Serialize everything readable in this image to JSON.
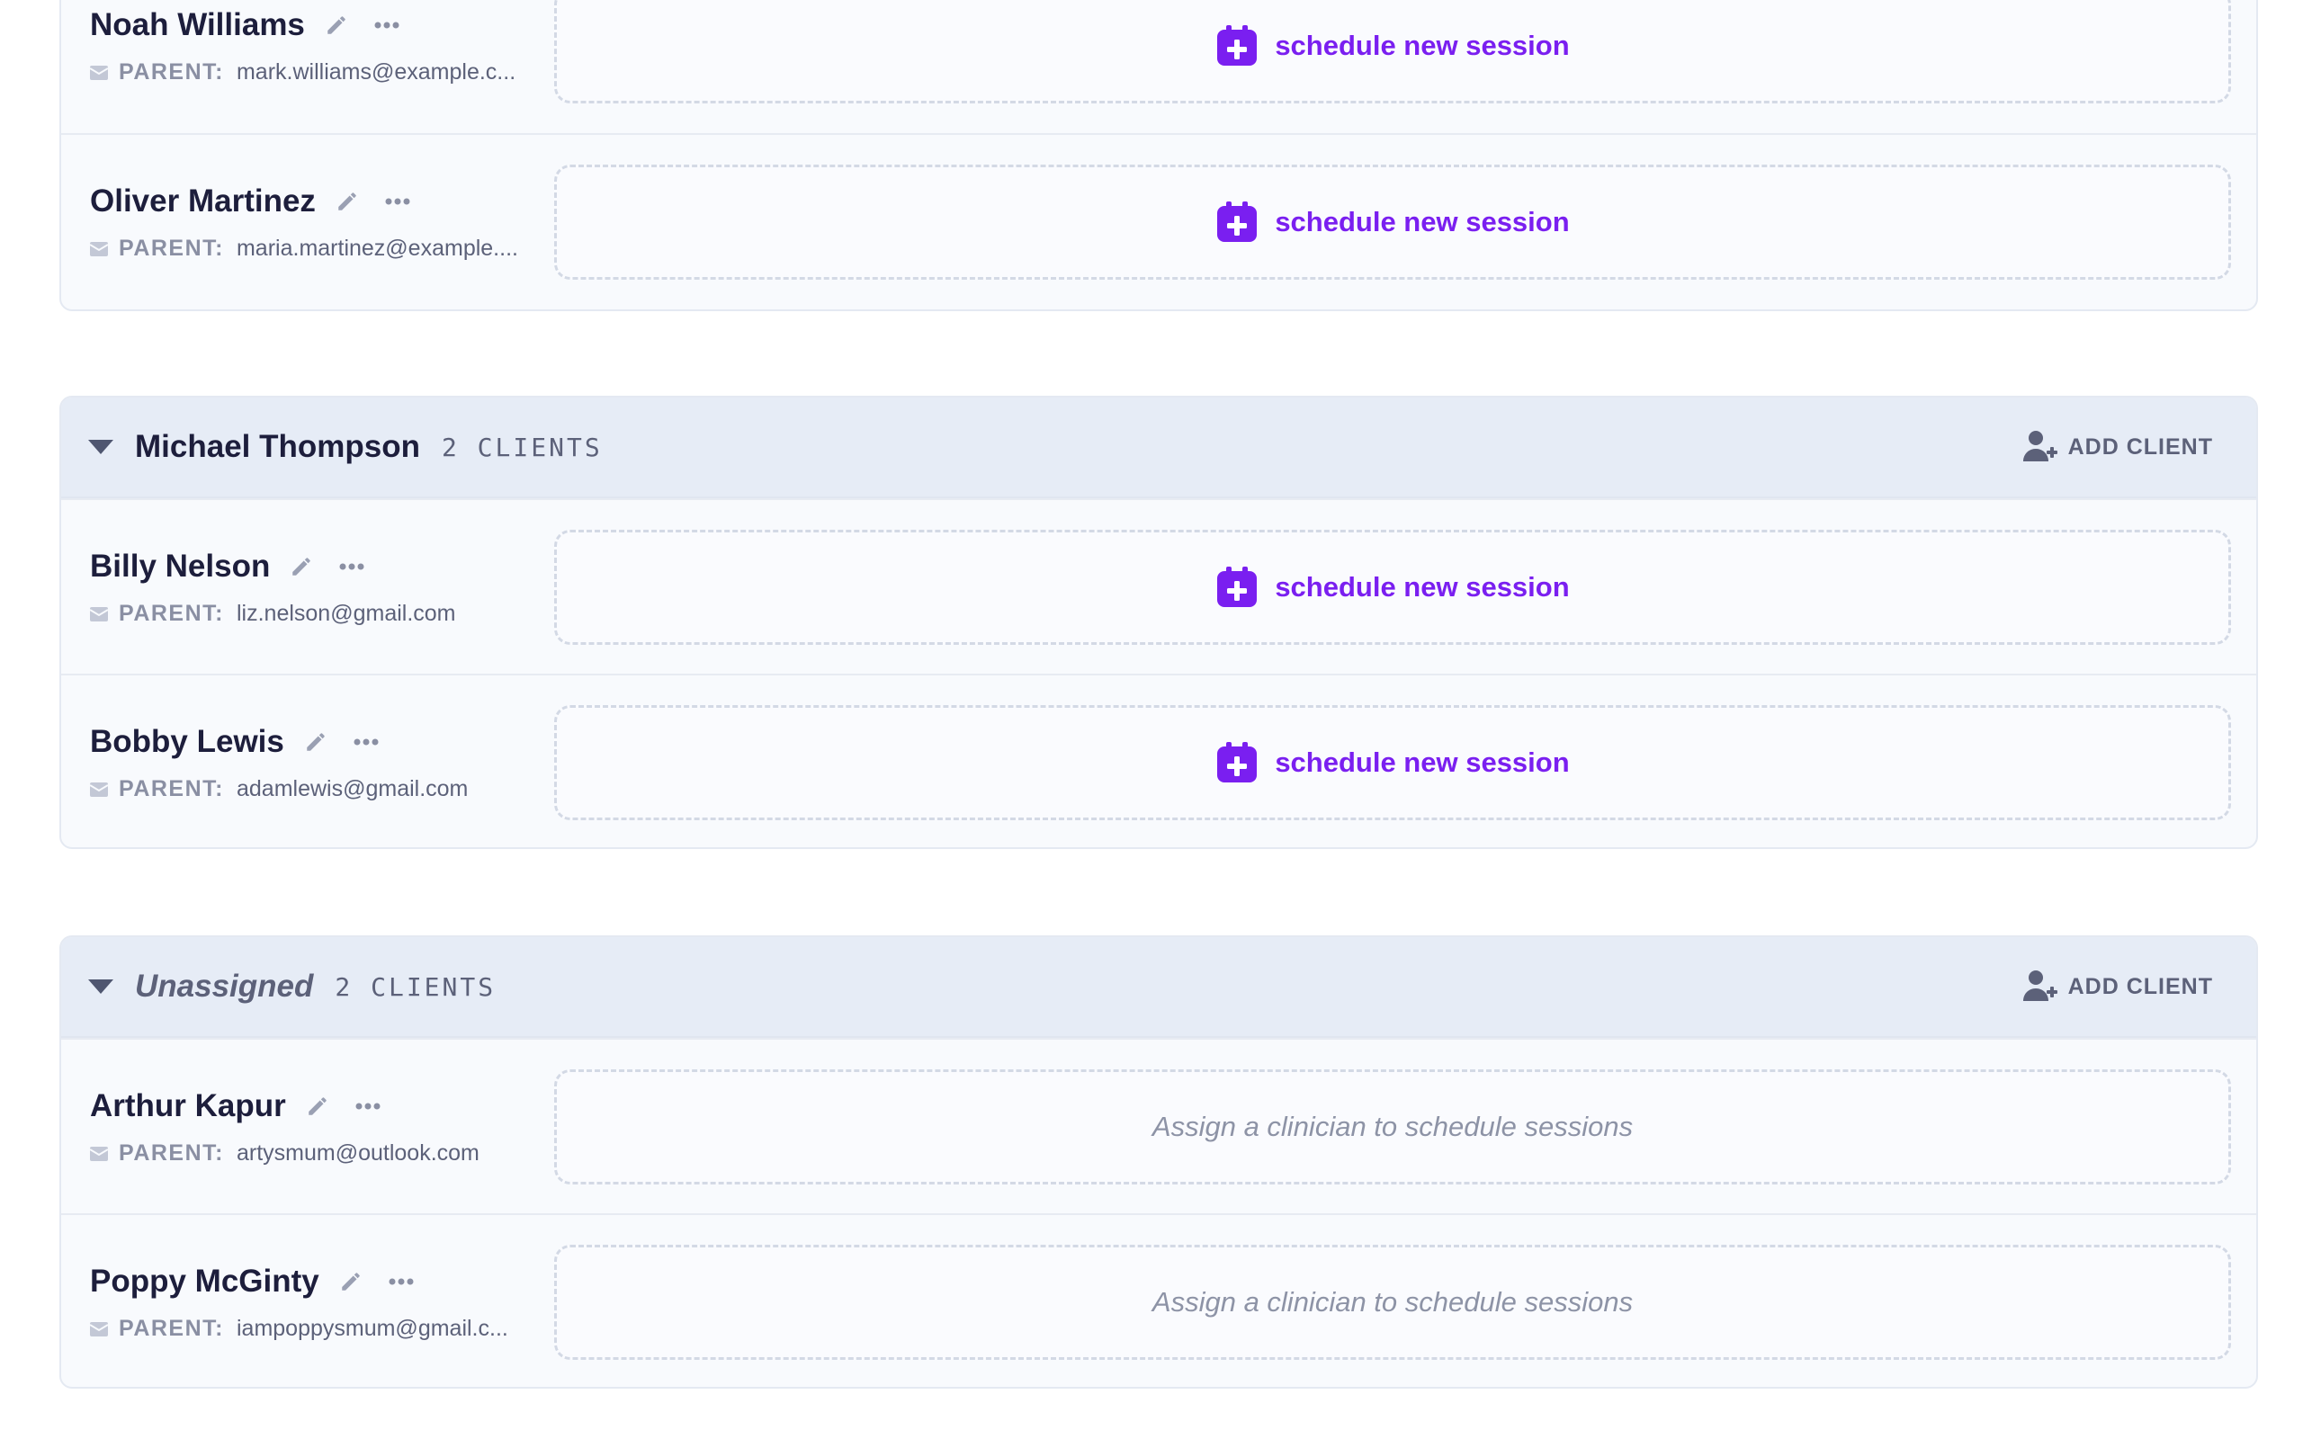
{
  "colors": {
    "accent": "#7a1ff0",
    "group_header_bg": "#e6ecf6",
    "muted_text": "#5c6179",
    "name_text": "#1d1e3c"
  },
  "groups": [
    {
      "name": "",
      "count": "",
      "clients": [
        {
          "name": "Noah Williams",
          "parent_label": "PARENT:",
          "parent_email": "mark.williams@example.c...",
          "session_label": "schedule new session"
        },
        {
          "name": "Oliver Martinez",
          "parent_label": "PARENT:",
          "parent_email": "maria.martinez@example....",
          "session_label": "schedule new session"
        }
      ]
    },
    {
      "name": "Michael Thompson",
      "count": "2 CLIENTS",
      "add_client_label": "ADD CLIENT",
      "clients": [
        {
          "name": "Billy Nelson",
          "parent_label": "PARENT:",
          "parent_email": "liz.nelson@gmail.com",
          "session_label": "schedule new session"
        },
        {
          "name": "Bobby Lewis",
          "parent_label": "PARENT:",
          "parent_email": "adamlewis@gmail.com",
          "session_label": "schedule new session"
        }
      ]
    },
    {
      "name": "Unassigned",
      "count": "2 CLIENTS",
      "add_client_label": "ADD CLIENT",
      "clients": [
        {
          "name": "Arthur Kapur",
          "parent_label": "PARENT:",
          "parent_email": "artysmum@outlook.com",
          "assign_text": "Assign a clinician to schedule sessions"
        },
        {
          "name": "Poppy McGinty",
          "parent_label": "PARENT:",
          "parent_email": "iampoppysmum@gmail.c...",
          "assign_text": "Assign a clinician to schedule sessions"
        }
      ]
    }
  ],
  "icons": {
    "edit": "pencil-icon",
    "more": "more-dots-icon",
    "parent": "mail-icon",
    "schedule": "calendar-plus-icon",
    "add_client": "add-user-icon",
    "collapse": "caret-down-icon"
  }
}
